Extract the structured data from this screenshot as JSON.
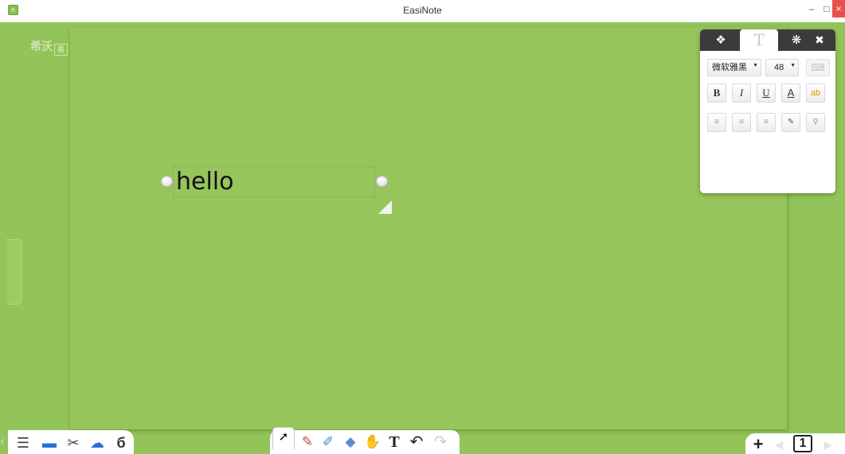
{
  "window": {
    "title": "EasiNote",
    "app_icon": "app-icon",
    "minimize_label": "–",
    "maximize_label": "□",
    "close_label": "×"
  },
  "logo": {
    "text": "希沃",
    "mark": "易"
  },
  "board": {
    "text_box": {
      "content": "hello"
    }
  },
  "side_handle": {
    "glyph": "⋮"
  },
  "properties_panel": {
    "tabs": [
      {
        "name": "style-icon",
        "glyph": "❖"
      },
      {
        "name": "text-icon",
        "glyph": "T"
      },
      {
        "name": "animation-icon",
        "glyph": "❋"
      },
      {
        "name": "close-icon",
        "glyph": "✖"
      }
    ],
    "font_family": "微软雅黑",
    "font_size": "48",
    "keyboard_glyph": "⌨",
    "format_buttons": [
      {
        "name": "bold-button",
        "label": "B"
      },
      {
        "name": "italic-button",
        "label": "I"
      },
      {
        "name": "underline-button",
        "label": "U"
      },
      {
        "name": "font-color-button",
        "label": "A"
      },
      {
        "name": "highlight-button",
        "label": "ab"
      }
    ],
    "align_buttons": [
      {
        "name": "align-left-button",
        "glyph": "≡"
      },
      {
        "name": "align-center-button",
        "glyph": "≡"
      },
      {
        "name": "align-right-button",
        "glyph": "≡"
      },
      {
        "name": "format-painter-button",
        "glyph": "✎"
      },
      {
        "name": "link-button",
        "glyph": "⚲"
      }
    ]
  },
  "bottom_left_toolbar": [
    {
      "name": "menu-icon",
      "glyph": "☰",
      "color": "#444444"
    },
    {
      "name": "display-icon",
      "glyph": "▬",
      "color": "#2a6fd6"
    },
    {
      "name": "tools-icon",
      "glyph": "✂",
      "color": "#444444"
    },
    {
      "name": "cloud-icon",
      "glyph": "☁",
      "color": "#2a6fd6"
    },
    {
      "name": "subject-tools-icon",
      "glyph": "б",
      "color": "#333333"
    }
  ],
  "bottom_mid_toolbar": [
    {
      "name": "select-icon",
      "glyph": "➚"
    },
    {
      "name": "pen-icon",
      "glyph": "✎"
    },
    {
      "name": "ruler-icon",
      "glyph": "✐"
    },
    {
      "name": "eraser-icon",
      "glyph": "◆"
    },
    {
      "name": "hand-roam-icon",
      "glyph": "✋"
    },
    {
      "name": "text-tool-icon",
      "glyph": "T"
    },
    {
      "name": "undo-icon",
      "glyph": "↶"
    },
    {
      "name": "redo-icon",
      "glyph": "↷"
    }
  ],
  "bottom_right_toolbar": {
    "add_page_glyph": "+",
    "prev_glyph": "◀",
    "page_number": "1",
    "next_glyph": "▶"
  },
  "colors": {
    "board_green": "#96c55b",
    "background_green": "#93c45a",
    "panel_tab_dark": "#3b3b3b",
    "close_red": "#e8514e"
  }
}
